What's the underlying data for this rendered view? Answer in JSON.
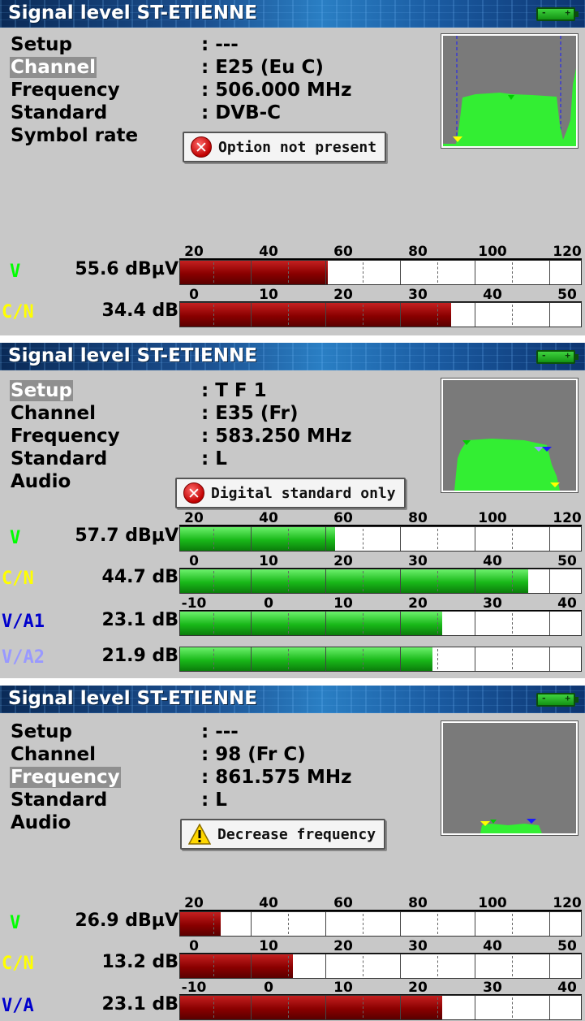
{
  "panels": [
    {
      "title": "Signal level  ST-ETIENNE",
      "info": [
        {
          "label": "Setup",
          "value": ": ---",
          "selected": false
        },
        {
          "label": "Channel",
          "value": ": E25  (Eu C)",
          "selected": true
        },
        {
          "label": "Frequency",
          "value": ": 506.000 MHz",
          "selected": false
        },
        {
          "label": "Standard",
          "value": ": DVB-C",
          "selected": false
        },
        {
          "label": "Symbol rate",
          "value": "",
          "selected": false
        }
      ],
      "popup": {
        "icon": "error-icon",
        "text": "Option not present"
      },
      "measurements": [
        {
          "name": "V",
          "name_color": "#00ff00",
          "value": "55.6 dBµV",
          "scale": [
            "20",
            "40",
            "60",
            "80",
            "100",
            "120"
          ],
          "scale_min": 20,
          "scale_max": 120,
          "level": 55.6,
          "fill": "red"
        },
        {
          "name": "C/N",
          "name_color": "#ffff00",
          "value": "34.4 dB",
          "scale": [
            "0",
            "10",
            "20",
            "30",
            "40",
            "50"
          ],
          "scale_min": 0,
          "scale_max": 50,
          "level": 34.4,
          "fill": "red"
        }
      ]
    },
    {
      "title": "Signal level  ST-ETIENNE",
      "info": [
        {
          "label": "Setup",
          "value": ": T F 1",
          "selected": true
        },
        {
          "label": "Channel",
          "value": ": E35  (Fr)",
          "selected": false
        },
        {
          "label": "Frequency",
          "value": ": 583.250 MHz",
          "selected": false
        },
        {
          "label": "Standard",
          "value": ": L",
          "selected": false
        },
        {
          "label": "Audio",
          "value": "",
          "selected": false
        }
      ],
      "popup": {
        "icon": "error-icon",
        "text": "Digital standard only"
      },
      "measurements": [
        {
          "name": "V",
          "name_color": "#00ff00",
          "value": "57.7 dBµV",
          "scale": [
            "20",
            "40",
            "60",
            "80",
            "100",
            "120"
          ],
          "scale_min": 20,
          "scale_max": 120,
          "level": 57.7,
          "fill": "green"
        },
        {
          "name": "C/N",
          "name_color": "#ffff00",
          "value": "44.7 dB",
          "scale": [
            "0",
            "10",
            "20",
            "30",
            "40",
            "50"
          ],
          "scale_min": 0,
          "scale_max": 50,
          "level": 44.7,
          "fill": "green"
        },
        {
          "name": "V/A1",
          "name_color": "#0000cc",
          "value": "23.1 dB",
          "scale": [
            "-10",
            "0",
            "10",
            "20",
            "30",
            "40"
          ],
          "scale_min": -10,
          "scale_max": 40,
          "level": 23.1,
          "fill": "green"
        },
        {
          "name": "V/A2",
          "name_color": "#9999ff",
          "value": "21.9 dB",
          "scale": [],
          "scale_min": -10,
          "scale_max": 40,
          "level": 21.9,
          "fill": "green"
        }
      ]
    },
    {
      "title": "Signal level  ST-ETIENNE",
      "info": [
        {
          "label": "Setup",
          "value": ": ---",
          "selected": false
        },
        {
          "label": "Channel",
          "value": ": 98  (Fr C)",
          "selected": false
        },
        {
          "label": "Frequency",
          "value": ": 861.575 MHz",
          "selected": true
        },
        {
          "label": "Standard",
          "value": ": L",
          "selected": false
        },
        {
          "label": "Audio",
          "value": "",
          "selected": false
        }
      ],
      "popup": {
        "icon": "warning-icon",
        "text": "Decrease frequency"
      },
      "measurements": [
        {
          "name": "V",
          "name_color": "#00ff00",
          "value": "26.9 dBµV",
          "scale": [
            "20",
            "40",
            "60",
            "80",
            "100",
            "120"
          ],
          "scale_min": 20,
          "scale_max": 120,
          "level": 26.9,
          "fill": "red"
        },
        {
          "name": "C/N",
          "name_color": "#ffff00",
          "value": "13.2 dB",
          "scale": [
            "0",
            "10",
            "20",
            "30",
            "40",
            "50"
          ],
          "scale_min": 0,
          "scale_max": 50,
          "level": 13.2,
          "fill": "red"
        },
        {
          "name": "V/A",
          "name_color": "#0000cc",
          "value": "23.1 dB",
          "scale": [
            "-10",
            "0",
            "10",
            "20",
            "30",
            "40"
          ],
          "scale_min": -10,
          "scale_max": 40,
          "level": 23.1,
          "fill": "red"
        }
      ]
    }
  ]
}
